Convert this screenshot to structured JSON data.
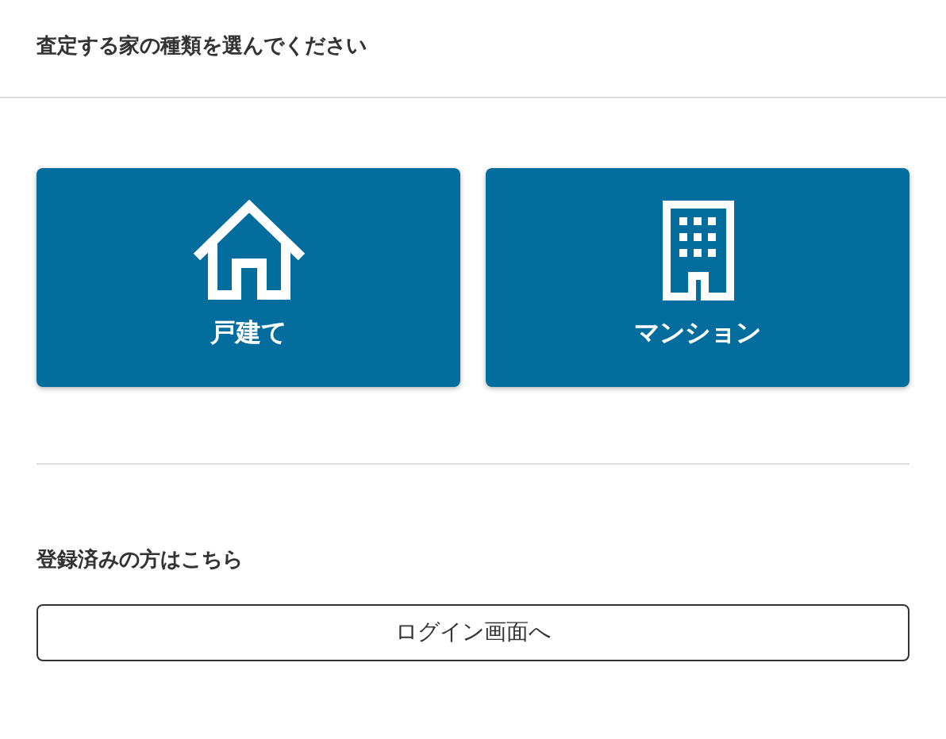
{
  "header": {
    "title": "査定する家の種類を選んでください"
  },
  "options": [
    {
      "kind": "house",
      "label": "戸建て"
    },
    {
      "kind": "building",
      "label": "マンション"
    }
  ],
  "login": {
    "label": "登録済みの方はこちら",
    "button": "ログイン画面へ"
  }
}
